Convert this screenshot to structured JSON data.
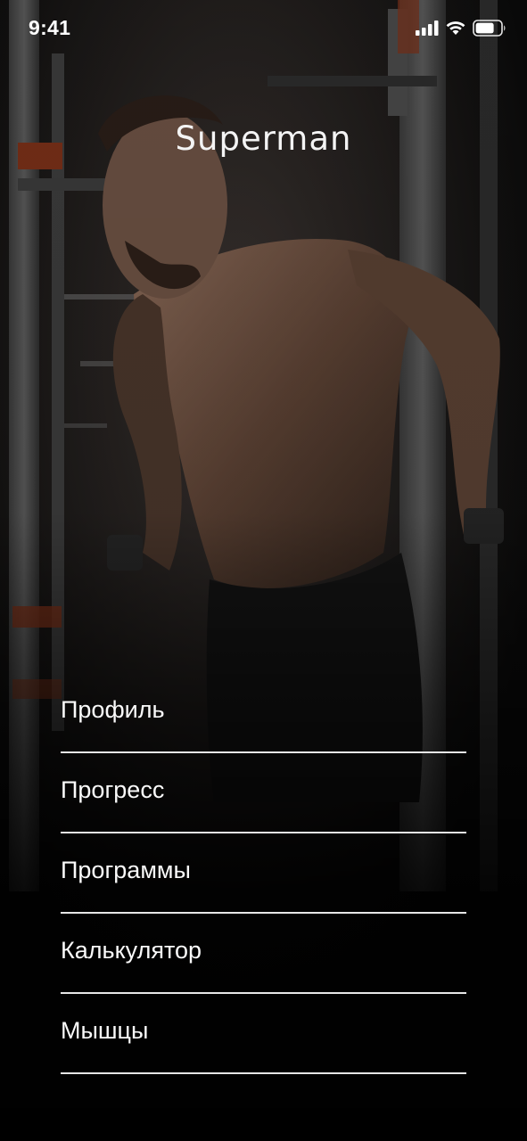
{
  "status_bar": {
    "time": "9:41"
  },
  "header": {
    "title": "Superman"
  },
  "menu": {
    "items": [
      {
        "label": "Профиль"
      },
      {
        "label": "Прогресс"
      },
      {
        "label": "Программы"
      },
      {
        "label": "Калькулятор"
      },
      {
        "label": "Мышцы"
      }
    ]
  },
  "icons": {
    "signal": "cellular-signal-icon",
    "wifi": "wifi-icon",
    "battery": "battery-icon"
  },
  "colors": {
    "background": "#050505",
    "text": "#ffffff",
    "divider": "#e6e6e6",
    "accent_orange": "#b8451f"
  }
}
